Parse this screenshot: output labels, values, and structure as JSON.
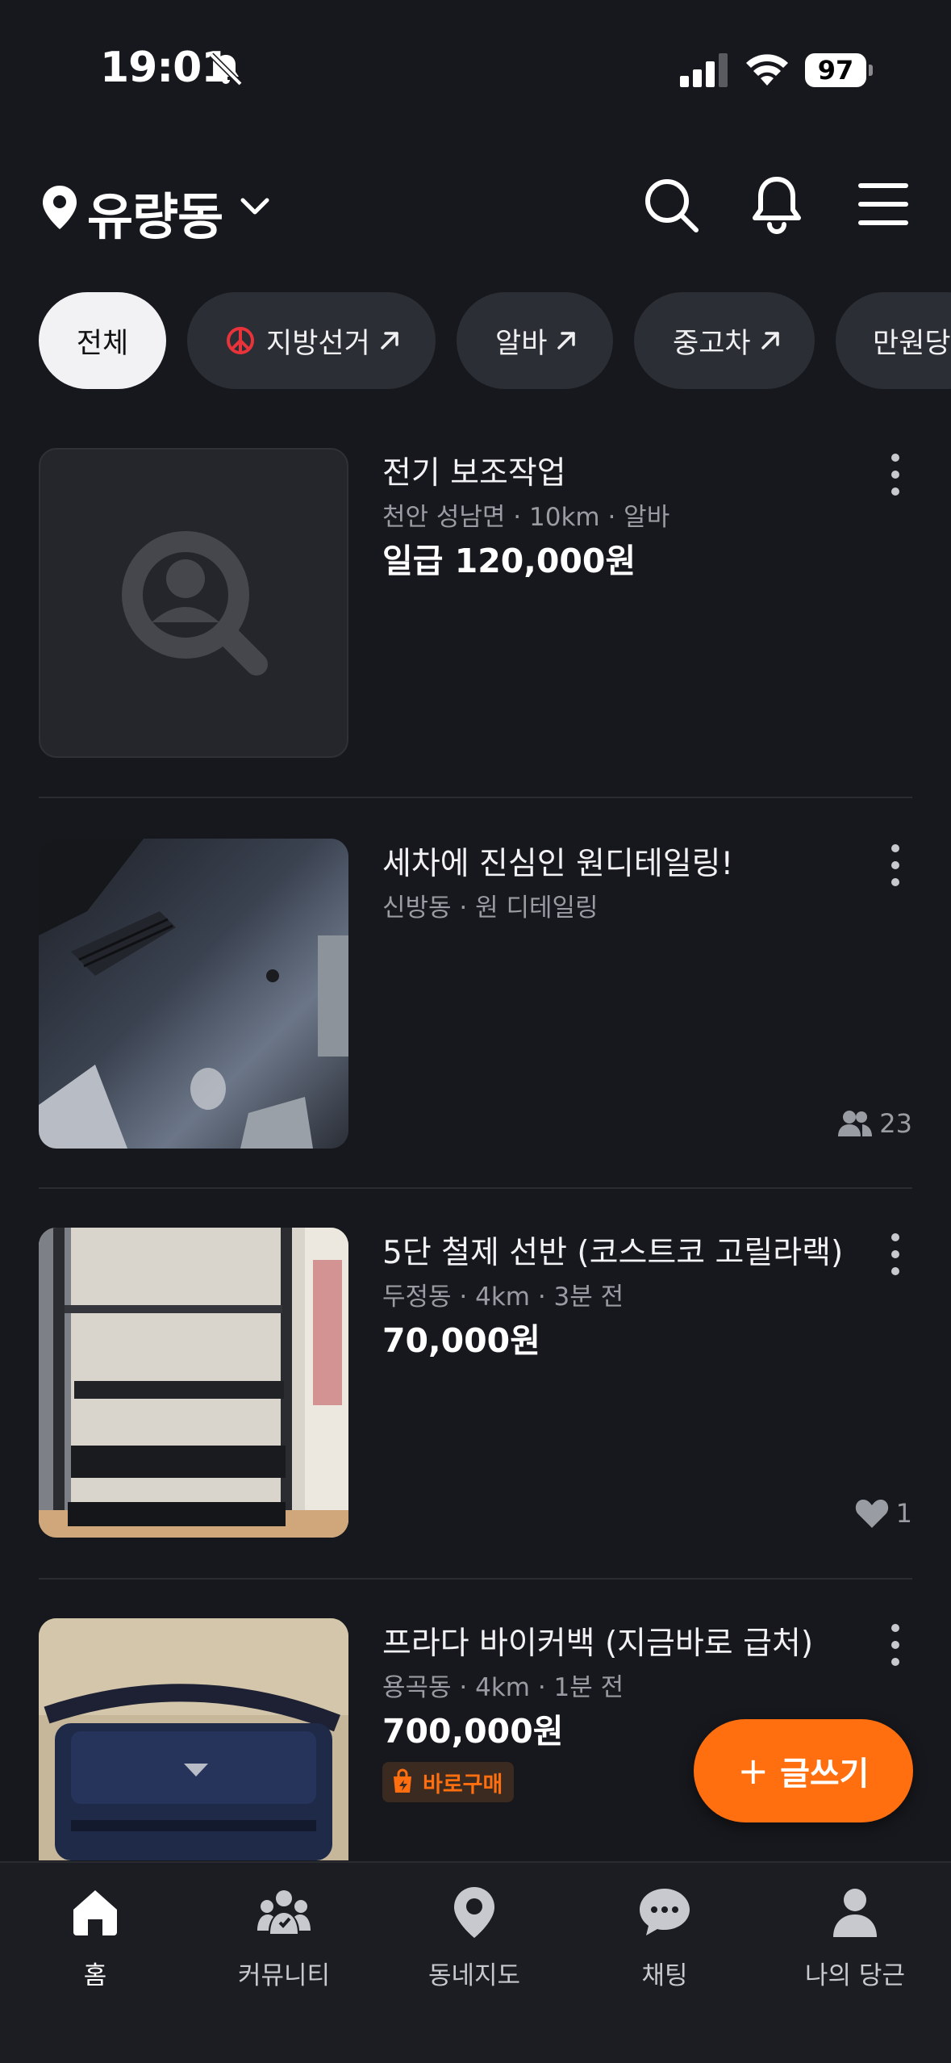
{
  "status_bar": {
    "time": "19:01",
    "battery": "97"
  },
  "header": {
    "location": "유량동"
  },
  "chips": [
    {
      "label": "전체"
    },
    {
      "label": "지방선거"
    },
    {
      "label": "알바"
    },
    {
      "label": "중고차"
    },
    {
      "label": "만원당"
    }
  ],
  "feed": [
    {
      "title": "전기 보조작업",
      "meta": "천안 성남면 · 10km · 알바",
      "price": "일급 120,000원"
    },
    {
      "title": "세차에 진심인 원디테일링!",
      "meta": "신방동 · 원 디테일링",
      "stat": "23"
    },
    {
      "title": "5단 철제 선반 (코스트코 고릴라랙)",
      "meta": "두정동 · 4km · 3분 전",
      "price": "70,000원",
      "stat": "1"
    },
    {
      "title": "프라다 바이커백 (지금바로 급처)",
      "meta": "용곡동 · 4km · 1분 전",
      "price": "700,000원",
      "badge": "바로구매"
    }
  ],
  "fab": {
    "label": "글쓰기"
  },
  "bottom_nav": [
    {
      "label": "홈",
      "icon": "home-icon"
    },
    {
      "label": "커뮤니티",
      "icon": "community-icon"
    },
    {
      "label": "동네지도",
      "icon": "map-pin-icon"
    },
    {
      "label": "채팅",
      "icon": "chat-icon"
    },
    {
      "label": "나의 당근",
      "icon": "profile-icon"
    }
  ],
  "colors": {
    "background": "#17181d",
    "accent": "#ff6f0f",
    "chip": "#2b2e35"
  }
}
